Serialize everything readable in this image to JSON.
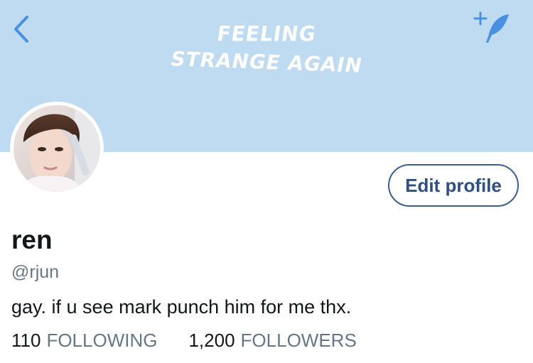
{
  "banner": {
    "line1": "FEELING",
    "line2": "STRANGE AGAIN",
    "color": "#bedbf2"
  },
  "nav": {
    "back_icon": "chevron-left-icon",
    "compose_icon": "sparkle-quill-icon",
    "icon_color": "#4a90e2"
  },
  "profile": {
    "display_name": "ren",
    "handle": "@rjun",
    "bio": "gay. if u see mark punch him for me thx.",
    "edit_button_label": "Edit profile"
  },
  "stats": {
    "following_count": "110",
    "following_label": "FOLLOWING",
    "followers_count": "1,200",
    "followers_label": "FOLLOWERS"
  },
  "colors": {
    "accent": "#3b5e8f",
    "secondary_text": "#657786",
    "primary_text": "#14171a"
  }
}
